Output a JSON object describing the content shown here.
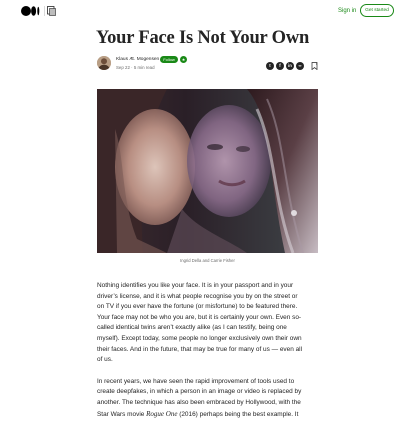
{
  "topbar": {
    "logo_icon": "medium-logo-icon",
    "publication_icon": "publication-icon",
    "signin_label": "Sign in",
    "get_started_label": "Get started"
  },
  "article": {
    "title": "Your Face Is Not Your Own",
    "author": {
      "name": "Klaus Æ. Mogensen",
      "follow_label": "Follow",
      "member_icon": "member-star-icon"
    },
    "meta": "Sep 22 · 5 min read",
    "share_icons": [
      "twitter-icon",
      "facebook-icon",
      "linkedin-icon",
      "link-icon"
    ],
    "bookmark_icon": "bookmark-icon",
    "image_caption": "Ingrid Della and Carrie Fisher",
    "paragraph1_lines": [
      "Nothing identifies you like your face. It is in your passport and in your",
      "driver’s license, and it is what people recognise you by on the street or",
      "on TV if you ever have the fortune (or misfortune) to be featured there.",
      "Your face may not be who you are, but it is certainly your own. Even so-",
      "called identical twins aren’t exactly alike (as I can testify, being one",
      "myself). Except today, some people no longer exclusively own their own",
      "their faces. And in the future, that may be true for many of us — even all",
      "of us."
    ],
    "paragraph2": {
      "line1": "In recent years, we have seen the rapid improvement of tools used to",
      "line2": "create deepfakes, in which a person in an image or video is replaced by",
      "line3": "another. The technique has also been embraced by Hollywood, with the",
      "line4_pre": "Star Wars movie ",
      "line4_movie": "Rogue One",
      "line4_post": " (2016) perhaps being the best example. It"
    }
  }
}
